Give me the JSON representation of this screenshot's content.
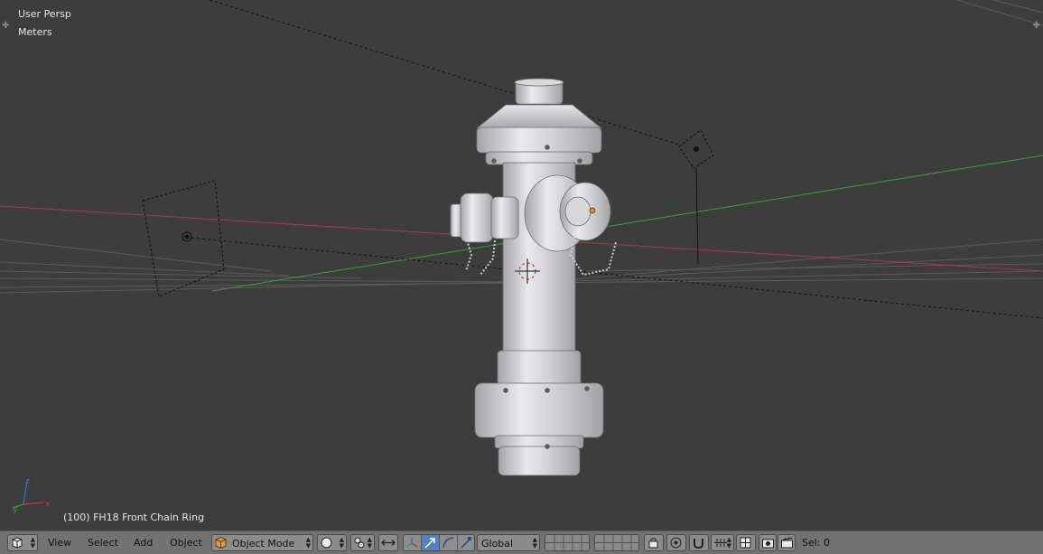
{
  "viewport": {
    "view_label": "User Persp",
    "units_label": "Meters",
    "active_object": "(100) FH18 Front Chain Ring",
    "axes": {
      "x": "x",
      "y": "y",
      "z": "z"
    },
    "colors": {
      "background": "#3d3d3d",
      "x_axis": "#a83c3c",
      "y_axis": "#3f9a3f",
      "model": "#c9c9cc"
    }
  },
  "header": {
    "editor_type_icon": "3d-view-icon",
    "menus": {
      "view": "View",
      "select": "Select",
      "add": "Add",
      "object": "Object"
    },
    "mode": {
      "label": "Object Mode",
      "icon": "cube-icon"
    },
    "shading_icon": "solid-sphere-icon",
    "pivot_icon": "pivot-point-icon",
    "manipulator_icons": [
      "manipulator-toggle-icon",
      "translate-icon",
      "rotate-icon",
      "scale-icon"
    ],
    "transform_orientation": "Global",
    "layer_icons": [
      "layers-icon"
    ],
    "lock_camera_icon": "lock-icon",
    "proportional_icon": "proportional-edit-icon",
    "snap_icons": [
      "magnet-icon",
      "snap-increment-icon",
      "snap-target-icon"
    ],
    "render_icons": [
      "camera-render-icon",
      "clapper-render-icon"
    ],
    "selection_count": "Sel: 0",
    "colors": {
      "bar": "#727272",
      "button": "#8c8c8c",
      "active": "#5680c2"
    }
  }
}
